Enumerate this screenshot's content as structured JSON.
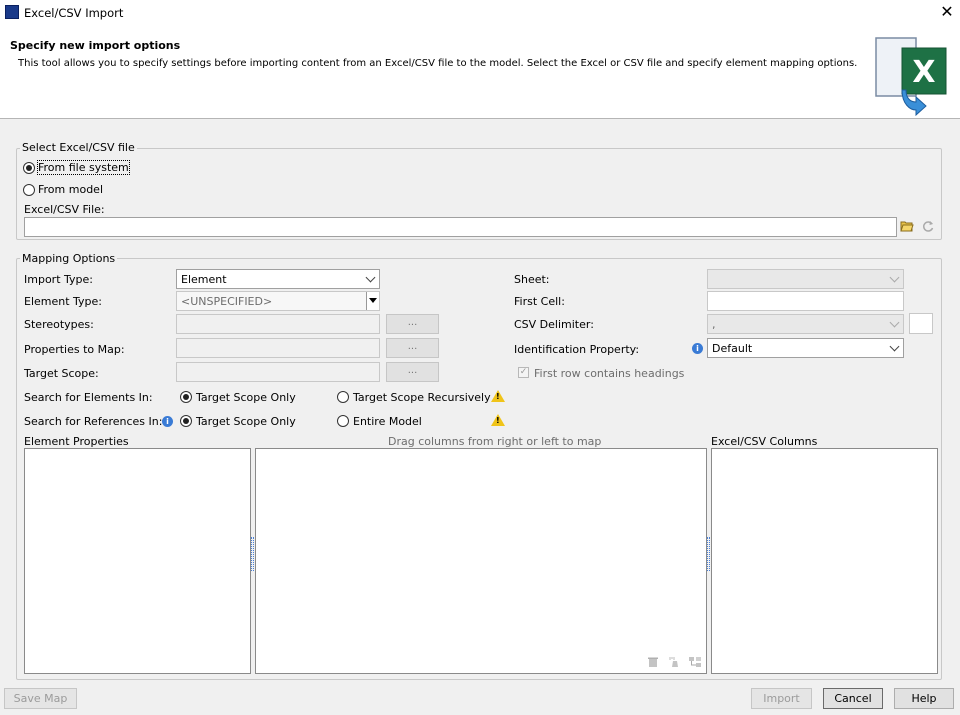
{
  "window": {
    "title": "Excel/CSV Import"
  },
  "header": {
    "title": "Specify new import options",
    "description": "This tool allows you to specify settings before importing content from an Excel/CSV file to the model. Select the Excel or CSV file and specify element mapping options."
  },
  "file_group": {
    "legend": "Select Excel/CSV file",
    "from_file_system": "From file system",
    "from_model": "From model",
    "file_label": "Excel/CSV File:",
    "file_value": ""
  },
  "mapping": {
    "legend": "Mapping Options",
    "import_type_label": "Import Type:",
    "import_type_value": "Element",
    "element_type_label": "Element Type:",
    "element_type_value": "<UNSPECIFIED>",
    "stereotypes_label": "Stereotypes:",
    "properties_label": "Properties to Map:",
    "target_scope_label": "Target Scope:",
    "dots": "...",
    "search_elements_label": "Search for Elements In:",
    "search_refs_label": "Search for References In:",
    "target_scope_only": "Target Scope Only",
    "target_scope_recursively": "Target Scope Recursively",
    "entire_model": "Entire Model",
    "sheet_label": "Sheet:",
    "first_cell_label": "First Cell:",
    "csv_delimiter_label": "CSV Delimiter:",
    "csv_delimiter_value": ",",
    "identification_label": "Identification Property:",
    "identification_value": "Default",
    "first_row_headings": "First row contains headings"
  },
  "panels": {
    "element_properties": "Element Properties",
    "drag_hint": "Drag columns from right or left to map",
    "excel_columns": "Excel/CSV Columns"
  },
  "buttons": {
    "save_map": "Save Map",
    "import": "Import",
    "cancel": "Cancel",
    "help": "Help"
  }
}
